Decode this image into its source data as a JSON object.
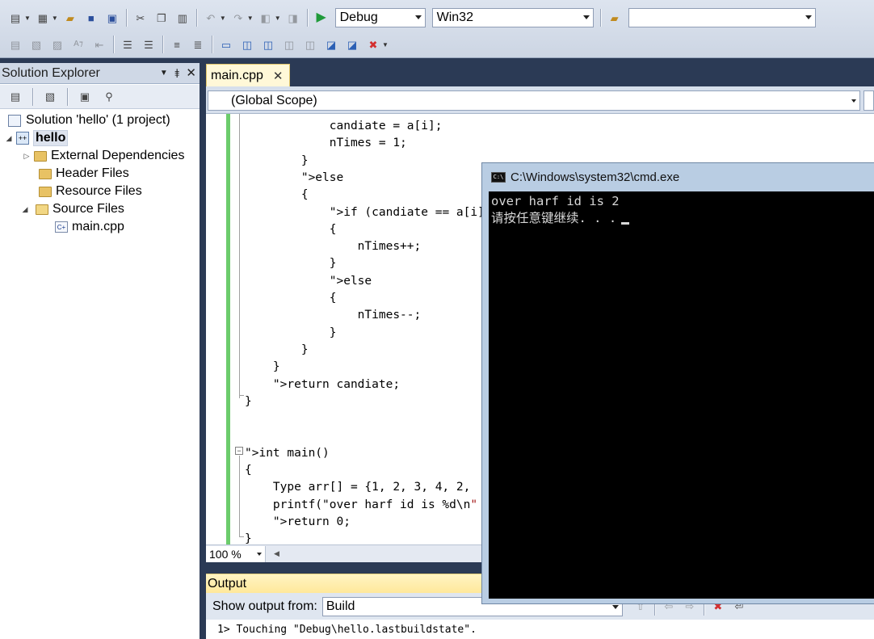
{
  "toolbar": {
    "config_combo": "Debug",
    "platform_combo": "Win32",
    "find_combo": ""
  },
  "solution_explorer": {
    "title": "Solution Explorer",
    "pin": "⯒",
    "close": "✕",
    "tree": {
      "solution": "Solution 'hello' (1 project)",
      "project": "hello",
      "external_deps": "External Dependencies",
      "header_files": "Header Files",
      "resource_files": "Resource Files",
      "source_files": "Source Files",
      "main_cpp": "main.cpp"
    }
  },
  "editor": {
    "tab_label": "main.cpp",
    "tab_close": "✕",
    "scope": "(Global Scope)",
    "zoom": "100 %",
    "lines": [
      {
        "text": "            candiate = a[i];"
      },
      {
        "text": "            nTimes = 1;"
      },
      {
        "text": "        }"
      },
      {
        "text": "        else",
        "kw": true
      },
      {
        "text": "        {"
      },
      {
        "text": "            if (candiate == a[i])",
        "if": true
      },
      {
        "text": "            {"
      },
      {
        "text": "                nTimes++;"
      },
      {
        "text": "            }"
      },
      {
        "text": "            else",
        "kw": true
      },
      {
        "text": "            {"
      },
      {
        "text": "                nTimes--;"
      },
      {
        "text": "            }"
      },
      {
        "text": "        }"
      },
      {
        "text": "    }"
      },
      {
        "text": "    return candiate;",
        "ret": true
      },
      {
        "text": "}"
      },
      {
        "text": ""
      },
      {
        "text": ""
      },
      {
        "text": "int main()",
        "main": true
      },
      {
        "text": "{"
      },
      {
        "text": "    Type arr[] = {1, 2, 3, 4, 2,"
      },
      {
        "text": "    printf(\"over harf id is %d\\n\"",
        "printf": true
      },
      {
        "text": "    return 0;",
        "ret0": true
      },
      {
        "text": "}"
      }
    ]
  },
  "output": {
    "title": "Output",
    "show_from_label": "Show output from:",
    "show_from_value": "Build",
    "line": "1>  Touching \"Debug\\hello.lastbuildstate\"."
  },
  "cmd": {
    "title": "C:\\Windows\\system32\\cmd.exe",
    "line1": "over harf id is 2",
    "line2": "请按任意键继续. . ."
  }
}
